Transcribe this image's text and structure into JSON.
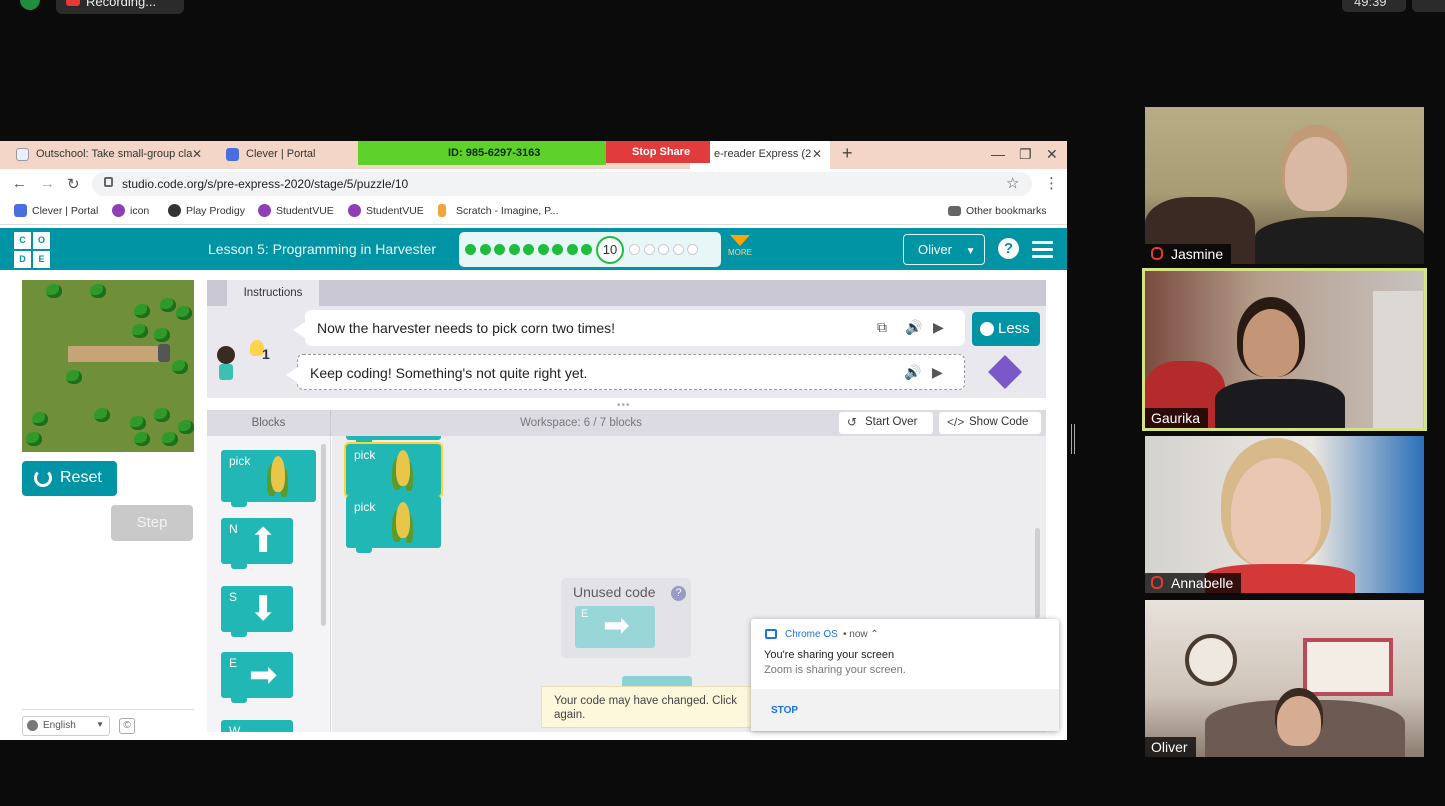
{
  "zoom": {
    "recording_label": "Recording...",
    "meeting_id": "ID: 985-6297-3163",
    "stop_share_label": "Stop Share",
    "clock": "49:39"
  },
  "browser": {
    "tabs": [
      {
        "title": "Outschool: Take small-group cla",
        "favicon_color": "#e8f0fe"
      },
      {
        "title": "Clever | Portal",
        "favicon_color": "#4a6ee0"
      },
      {
        "title": "e-reader Express (2",
        "favicon_color": "#00adbc"
      }
    ],
    "new_tab": "+",
    "url": "studio.code.org/s/pre-express-2020/stage/5/puzzle/10",
    "bookmarks": [
      {
        "label": "Clever | Portal",
        "color": "#4a6ee0"
      },
      {
        "label": "icon",
        "color": "#8e3fb5"
      },
      {
        "label": "Play Prodigy",
        "color": "#333333"
      },
      {
        "label": "StudentVUE",
        "color": "#8e3fb5"
      },
      {
        "label": "StudentVUE",
        "color": "#8e3fb5"
      },
      {
        "label": "Scratch - Imagine, P...",
        "color": "#f0a43a"
      }
    ],
    "other_bookmarks": "Other bookmarks"
  },
  "codeorg": {
    "logo_letters": [
      "C",
      "O",
      "D",
      "E"
    ],
    "lesson_title": "Lesson 5: Programming in Harvester",
    "current_puzzle": "10",
    "completed_dots": 9,
    "remaining_dots": 5,
    "more_label": "MORE",
    "user_name": "Oliver",
    "help_glyph": "?"
  },
  "game": {
    "reset_label": "Reset",
    "step_label": "Step",
    "language": "English",
    "copyright_glyph": "©"
  },
  "instructions": {
    "tab_label": "Instructions",
    "hint_count": "1",
    "message_1": "Now the harvester needs to pick corn two times!",
    "message_2": "Keep coding! Something's not quite right yet.",
    "less_label": "Less"
  },
  "workspace": {
    "blocks_label": "Blocks",
    "count_label": "Workspace: 6 / 7 blocks",
    "start_over_label": "Start Over",
    "show_code_label": "Show Code",
    "toolbox_blocks": [
      {
        "label": "pick",
        "kind": "corn"
      },
      {
        "label": "N",
        "kind": "arrow",
        "glyph": "⬆"
      },
      {
        "label": "S",
        "kind": "arrow",
        "glyph": "⬇"
      },
      {
        "label": "E",
        "kind": "arrow",
        "glyph": "➡"
      },
      {
        "label": "W",
        "kind": "arrow",
        "glyph": "⬅"
      }
    ],
    "program_blocks": [
      {
        "label": "pick"
      },
      {
        "label": "pick"
      }
    ],
    "unused_label": "Unused code",
    "unused_help": "?",
    "unused_block_label": "E",
    "unused_block_glyph": "➡",
    "feedback_message": "Your code may have changed. Click again."
  },
  "notification": {
    "source": "Chrome OS",
    "time": "• now ⌃",
    "title": "You're sharing your screen",
    "body": "Zoom is sharing your screen.",
    "action": "STOP"
  },
  "participants": [
    {
      "name": "Jasmine",
      "muted": true,
      "speaker": false
    },
    {
      "name": "Gaurika",
      "muted": false,
      "speaker": true
    },
    {
      "name": "Annabelle",
      "muted": true,
      "speaker": false
    },
    {
      "name": "Oliver",
      "muted": false,
      "speaker": false
    }
  ]
}
